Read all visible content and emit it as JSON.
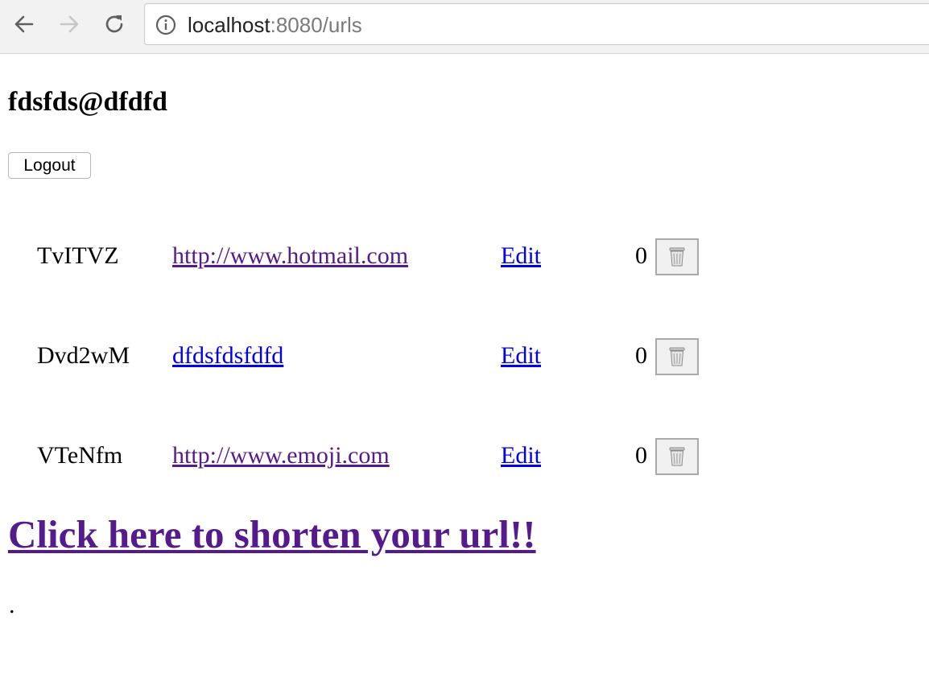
{
  "browser": {
    "url_host": "localhost",
    "url_rest": ":8080/urls"
  },
  "user": {
    "email": "fdsfds@dfdfd"
  },
  "logout_label": "Logout",
  "urls": [
    {
      "short_id": "TvITVZ",
      "long_url": "http://www.hotmail.com",
      "edit_label": "Edit",
      "count": "0"
    },
    {
      "short_id": "Dvd2wM",
      "long_url": "dfdsfdsfdfd",
      "edit_label": "Edit",
      "count": "0"
    },
    {
      "short_id": "VTeNfm",
      "long_url": "http://www.emoji.com",
      "edit_label": "Edit",
      "count": "0"
    }
  ],
  "shorten_link_label": "Click here to shorten your url!!",
  "footer_text": ".",
  "icons": {
    "back": "arrow-left-icon",
    "forward": "arrow-right-icon",
    "reload": "reload-icon",
    "info": "info-icon",
    "delete": "trash-icon"
  },
  "colors": {
    "visited_link": "#551a8b",
    "unvisited_link": "#0000ee"
  }
}
